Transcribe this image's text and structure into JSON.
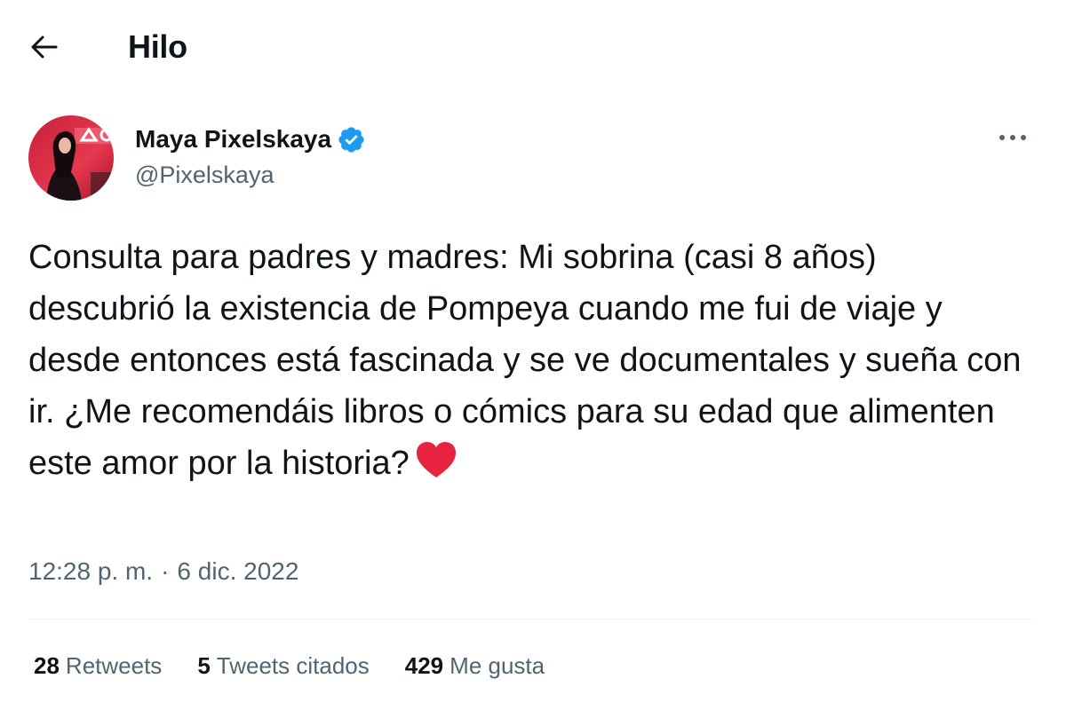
{
  "header": {
    "title": "Hilo",
    "back_icon": "arrow-left-icon"
  },
  "tweet": {
    "author": {
      "name": "Maya Pixelskaya",
      "handle": "@Pixelskaya",
      "verified": true,
      "verified_color": "#1d9bf0"
    },
    "text": "Consulta para padres y madres: Mi sobrina (casi 8 años) descubrió la existencia de Pompeya cuando me fui de viaje y desde entonces está fascinada y se ve documentales y sueña con ir. ¿Me recomendáis libros o cómics para su edad que alimenten este amor por la historia?",
    "emoji": "red-heart",
    "time": "12:28 p. m.",
    "separator": "·",
    "date": "6 dic. 2022",
    "stats": {
      "retweets_count": "28",
      "retweets_label": "Retweets",
      "quotes_count": "5",
      "quotes_label": "Tweets citados",
      "likes_count": "429",
      "likes_label": "Me gusta"
    }
  },
  "colors": {
    "text_primary": "#0f1419",
    "text_secondary": "#536471",
    "divider": "#eff3f4",
    "heart": "#e8233f"
  }
}
